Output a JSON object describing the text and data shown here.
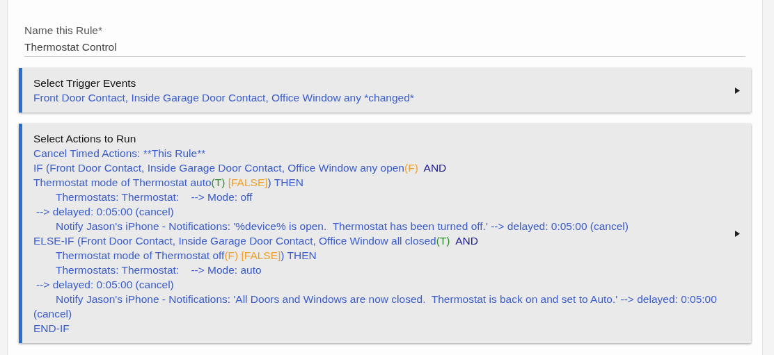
{
  "name_field": {
    "label": "Name this Rule*",
    "value": "Thermostat Control"
  },
  "sections": [
    {
      "title": "Select Trigger Events",
      "lines": [
        {
          "kind": "plain",
          "parts": [
            {
              "kind": "text",
              "text": "Front Door Contact, Inside Garage Door Contact, Office Window any *changed*"
            }
          ]
        }
      ]
    },
    {
      "title": "Select Actions to Run",
      "lines": [
        {
          "kind": "plain",
          "parts": [
            {
              "kind": "text",
              "text": "Cancel Timed Actions: **This Rule**"
            }
          ]
        },
        {
          "kind": "plain",
          "parts": [
            {
              "kind": "text",
              "text": "IF (Front Door Contact, Inside Garage Door Contact, Office Window any open"
            },
            {
              "kind": "false",
              "text": "(F)"
            },
            {
              "kind": "keyword",
              "text": "  AND"
            }
          ]
        },
        {
          "kind": "plain",
          "parts": [
            {
              "kind": "text",
              "text": "Thermostat mode of Thermostat auto"
            },
            {
              "kind": "true",
              "text": "(T)"
            },
            {
              "kind": "false",
              "text": " [FALSE]"
            },
            {
              "kind": "text",
              "text": ") THEN"
            }
          ]
        },
        {
          "kind": "indented",
          "parts": [
            {
              "kind": "text",
              "text": "Thermostats: Thermostat:    --> Mode: off"
            }
          ]
        },
        {
          "kind": "continuation",
          "parts": [
            {
              "kind": "text",
              "text": "--> delayed: 0:05:00 (cancel)"
            }
          ]
        },
        {
          "kind": "indented",
          "parts": [
            {
              "kind": "text",
              "text": "Notify Jason's iPhone - Notifications: '%device% is open.  Thermostat has been turned off.' --> delayed: 0:05:00 (cancel)"
            }
          ]
        },
        {
          "kind": "plain",
          "parts": [
            {
              "kind": "text",
              "text": "ELSE-IF (Front Door Contact, Inside Garage Door Contact, Office Window all closed"
            },
            {
              "kind": "true",
              "text": "(T)"
            },
            {
              "kind": "keyword",
              "text": "  AND"
            }
          ]
        },
        {
          "kind": "indented",
          "parts": [
            {
              "kind": "text",
              "text": "Thermostat mode of Thermostat off"
            },
            {
              "kind": "false",
              "text": "(F) [FALSE]"
            },
            {
              "kind": "text",
              "text": ") THEN"
            }
          ]
        },
        {
          "kind": "indented",
          "parts": [
            {
              "kind": "text",
              "text": "Thermostats: Thermostat:    --> Mode: auto"
            }
          ]
        },
        {
          "kind": "continuation",
          "parts": [
            {
              "kind": "text",
              "text": "--> delayed: 0:05:00 (cancel)"
            }
          ]
        },
        {
          "kind": "indented",
          "parts": [
            {
              "kind": "text",
              "text": "Notify Jason's iPhone - Notifications: 'All Doors and Windows are now closed.  Thermostat is back on and set to Auto.' --> delayed: 0:05:00 (cancel)"
            }
          ]
        },
        {
          "kind": "plain",
          "parts": [
            {
              "kind": "text",
              "text": "END-IF"
            }
          ]
        }
      ]
    }
  ]
}
